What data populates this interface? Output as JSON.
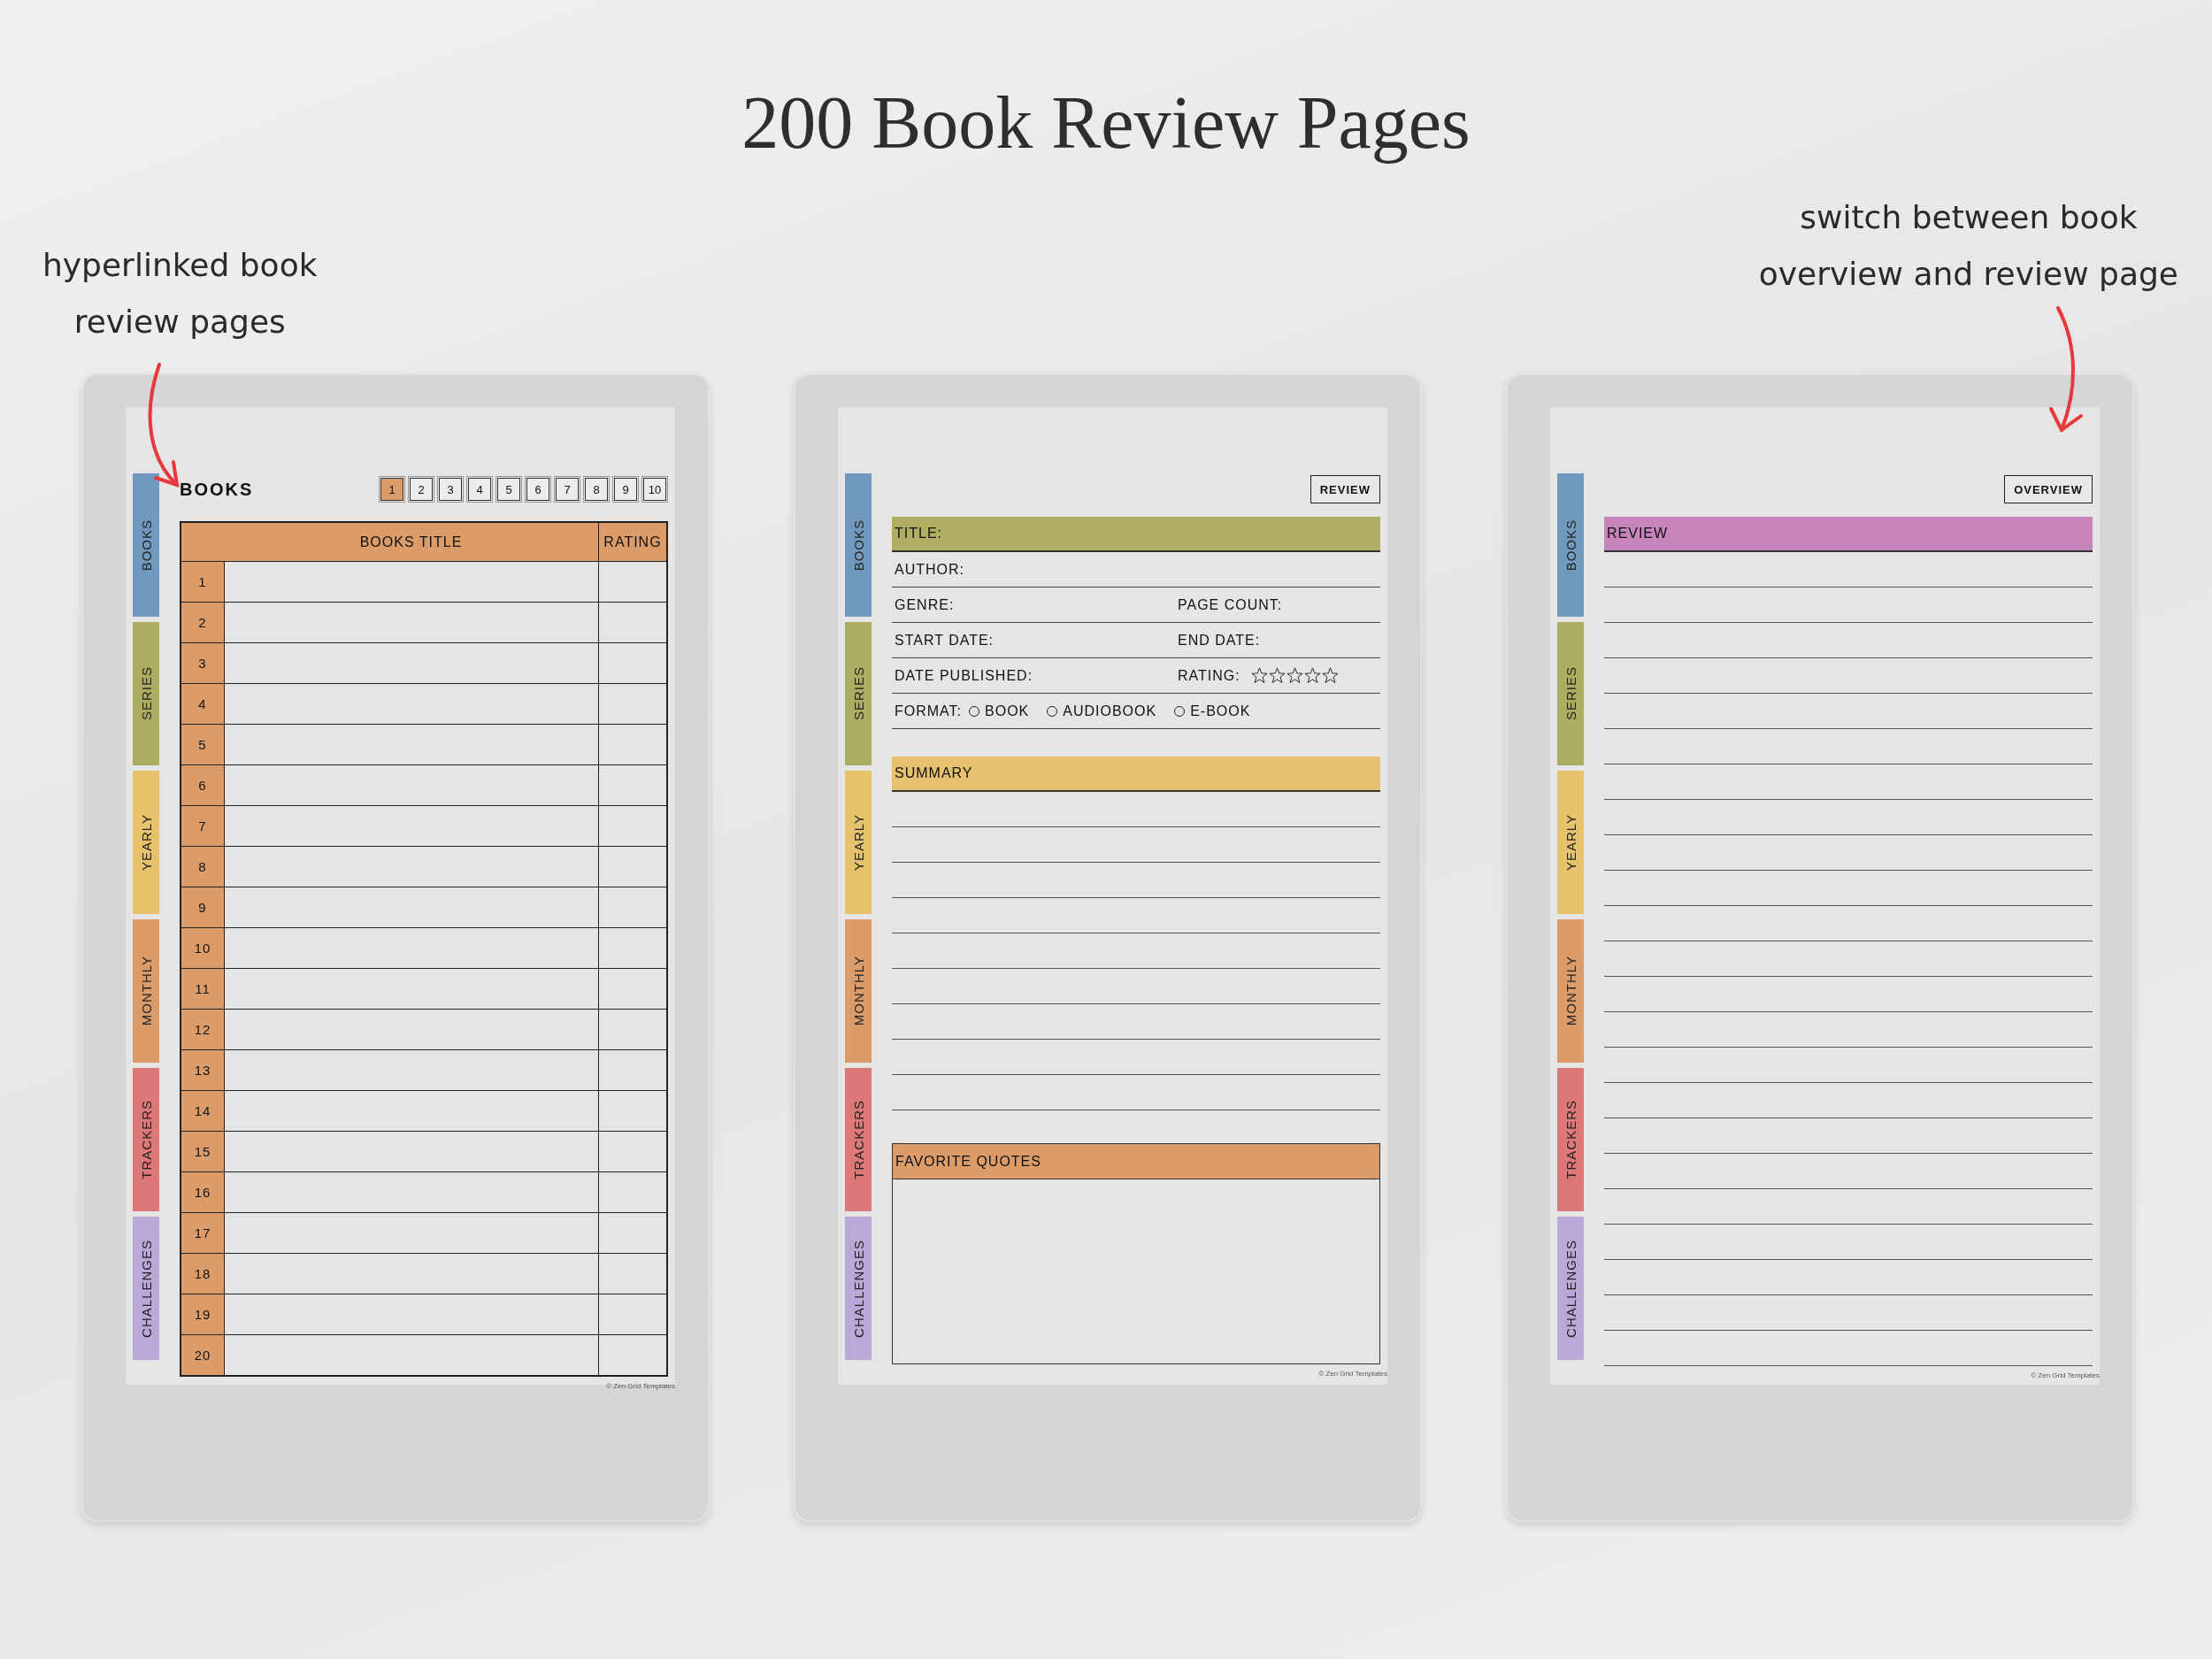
{
  "title": "200 Book Review Pages",
  "annotations": [
    {
      "text": "hyperlinked book\nreview pages"
    },
    {
      "text": "switch between book\noverview and review page"
    }
  ],
  "devices": [
    {
      "kind": "overview",
      "tabs": [
        {
          "label": "BOOKS",
          "color": "#7199bd"
        },
        {
          "label": "SERIES",
          "color": "#adad62"
        },
        {
          "label": "YEARLY",
          "color": "#e6c26c"
        },
        {
          "label": "MONTHLY",
          "color": "#dc9c69"
        },
        {
          "label": "TRACKERS",
          "color": "#de7878"
        },
        {
          "label": "CHALLENGES",
          "color": "#b9a8d8"
        }
      ],
      "heading": "BOOKS",
      "page_buttons": [
        {
          "label": "1",
          "selected": true
        },
        {
          "label": "2",
          "selected": false
        },
        {
          "label": "3",
          "selected": false
        },
        {
          "label": "4",
          "selected": false
        },
        {
          "label": "5",
          "selected": false
        },
        {
          "label": "6",
          "selected": false
        },
        {
          "label": "7",
          "selected": false
        },
        {
          "label": "8",
          "selected": false
        },
        {
          "label": "9",
          "selected": false
        },
        {
          "label": "10",
          "selected": false
        }
      ],
      "table": {
        "columns": [
          "BOOKS TITLE",
          "RATING"
        ],
        "rows": [
          "1",
          "2",
          "3",
          "4",
          "5",
          "6",
          "7",
          "8",
          "9",
          "10",
          "11",
          "12",
          "13",
          "14",
          "15",
          "16",
          "17",
          "18",
          "19",
          "20"
        ]
      },
      "footer": "© Zen Grid Templates"
    },
    {
      "kind": "detail",
      "tabs": [
        {
          "label": "BOOKS",
          "color": "#7199bd"
        },
        {
          "label": "SERIES",
          "color": "#adad62"
        },
        {
          "label": "YEARLY",
          "color": "#e6c26c"
        },
        {
          "label": "MONTHLY",
          "color": "#dc9c69"
        },
        {
          "label": "TRACKERS",
          "color": "#de7878"
        },
        {
          "label": "CHALLENGES",
          "color": "#b9a8d8"
        }
      ],
      "nav_button": "REVIEW",
      "blocks": [
        {
          "kind": "fields",
          "rows": [
            {
              "kind": "bar",
              "label": "TITLE:",
              "color": "#b0ae63"
            },
            {
              "kind": "single",
              "label": "AUTHOR:"
            },
            {
              "kind": "pair",
              "labels": [
                "GENRE:",
                "PAGE COUNT:"
              ]
            },
            {
              "kind": "pair",
              "labels": [
                "START DATE:",
                "END DATE:"
              ]
            },
            {
              "kind": "rating",
              "labels": [
                "DATE PUBLISHED:",
                "RATING:"
              ],
              "stars": 0
            },
            {
              "kind": "options",
              "label": "FORMAT:",
              "options": [
                {
                  "label": "BOOK",
                  "selected": false
                },
                {
                  "label": "AUDIOBOOK",
                  "selected": false
                },
                {
                  "label": "E-BOOK",
                  "selected": false
                }
              ]
            }
          ]
        },
        {
          "kind": "lined",
          "heading": "SUMMARY",
          "color": "#e6c06c"
        },
        {
          "kind": "box",
          "heading": "FAVORITE QUOTES",
          "color": "#dc9c69"
        }
      ],
      "footer": "© Zen Grid Templates"
    },
    {
      "kind": "review",
      "tabs": [
        {
          "label": "BOOKS",
          "color": "#7199bd"
        },
        {
          "label": "SERIES",
          "color": "#adad62"
        },
        {
          "label": "YEARLY",
          "color": "#e6c26c"
        },
        {
          "label": "MONTHLY",
          "color": "#dc9c69"
        },
        {
          "label": "TRACKERS",
          "color": "#de7878"
        },
        {
          "label": "CHALLENGES",
          "color": "#b9a8d8"
        }
      ],
      "nav_button": "OVERVIEW",
      "blocks": [
        {
          "kind": "lined",
          "heading": "REVIEW",
          "color": "#c585bb"
        }
      ],
      "footer": "© Zen Grid Templates"
    }
  ]
}
